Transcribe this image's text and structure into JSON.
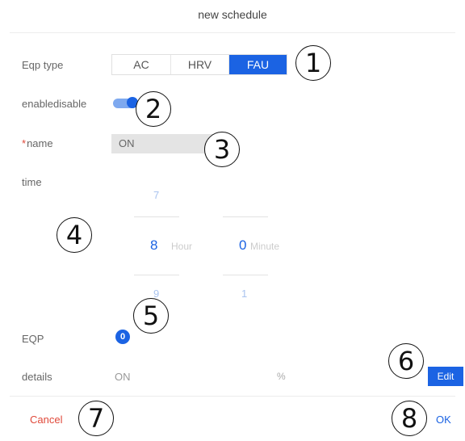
{
  "header": {
    "title": "new schedule"
  },
  "eqp_type": {
    "label": "Eqp type",
    "options": [
      {
        "label": "AC",
        "selected": false
      },
      {
        "label": "HRV",
        "selected": false
      },
      {
        "label": "FAU",
        "selected": true
      }
    ]
  },
  "enable": {
    "label": "enabledisable",
    "on": true
  },
  "name": {
    "required_mark": "*",
    "label": "name",
    "value": "ON"
  },
  "time": {
    "label": "time",
    "hour": {
      "prev": "7",
      "value": "8",
      "next": "9",
      "unit": "Hour"
    },
    "minute": {
      "value": "0",
      "next": "1",
      "unit": "Minute"
    }
  },
  "eqp": {
    "label": "EQP",
    "count": "0"
  },
  "details": {
    "label": "details",
    "value": "ON",
    "unit": "%",
    "edit_label": "Edit"
  },
  "footer": {
    "cancel_label": "Cancel",
    "ok_label": "OK"
  },
  "callouts": [
    "1",
    "2",
    "3",
    "4",
    "5",
    "6",
    "7",
    "8"
  ],
  "colors": {
    "accent": "#1b63e3",
    "danger": "#e0493a"
  }
}
